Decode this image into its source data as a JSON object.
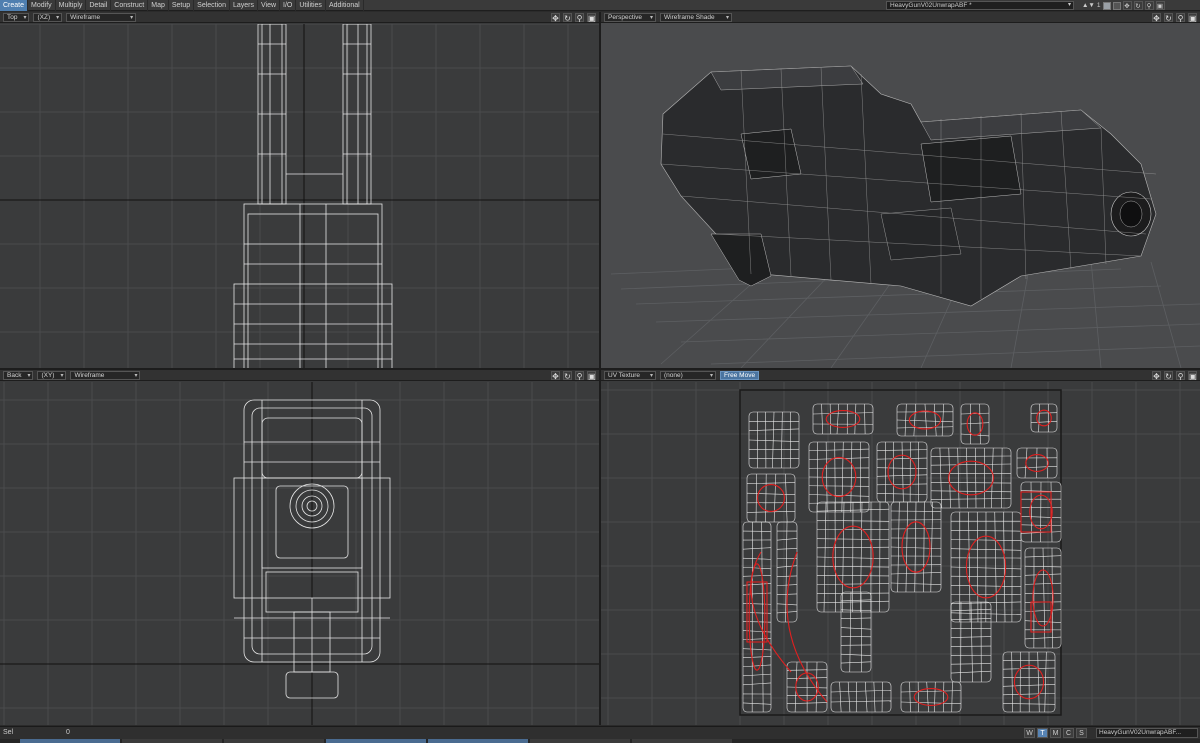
{
  "menu": {
    "tabs": [
      "Create",
      "Modify",
      "Multiply",
      "Detail",
      "Construct",
      "Map",
      "Setup",
      "Selection",
      "Layers",
      "View",
      "I/O",
      "Utilities",
      "Additional"
    ],
    "active": "Create"
  },
  "scene": {
    "object_name": "HeavyGunV02UnwrapABF *",
    "layer_number": "1"
  },
  "viewports": {
    "top": {
      "view": "Top",
      "axes": "(XZ)",
      "render_mode": "Wireframe"
    },
    "perspective": {
      "view": "Perspective",
      "render_mode": "Wireframe Shade"
    },
    "back": {
      "view": "Back",
      "axes": "(XY)",
      "render_mode": "Wireframe"
    },
    "uv": {
      "view": "UV Texture",
      "uv_map": "(none)",
      "move_mode": "Free Move"
    }
  },
  "tool_icons": [
    "move-icon",
    "rotate-icon",
    "zoom-icon",
    "maximize-icon"
  ],
  "status": {
    "sel_label": "Sel",
    "sel_value": "0",
    "modes": [
      "W",
      "T",
      "M",
      "C",
      "S"
    ],
    "active_mode": "T",
    "uv_map_select": "HeavyGunV02UnwrapABF..."
  },
  "colors": {
    "accent": "#4f7fb0",
    "viewport_bg": "#3a3b3c",
    "uv_seam": "#e02020",
    "wire": "#e8e8e8"
  }
}
